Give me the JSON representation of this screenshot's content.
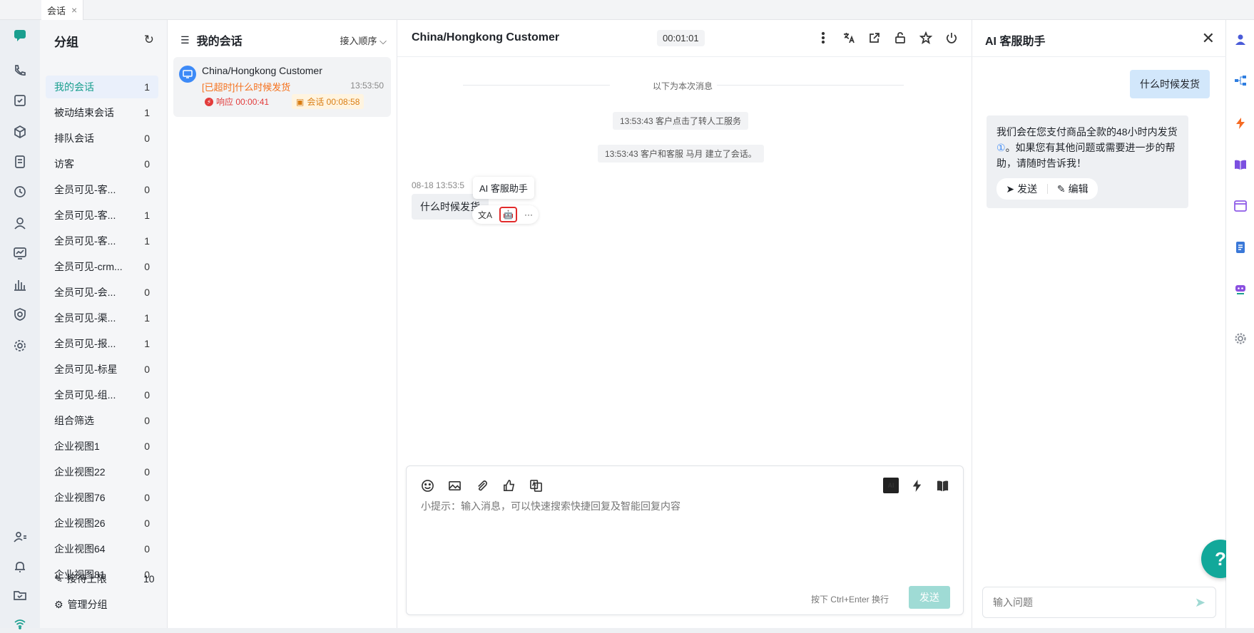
{
  "top_tab": {
    "label": "会话",
    "close": "×"
  },
  "groups": {
    "title": "分组",
    "items": [
      {
        "label": "我的会话",
        "count": "1"
      },
      {
        "label": "被动结束会话",
        "count": "1"
      },
      {
        "label": "排队会话",
        "count": "0"
      },
      {
        "label": "访客",
        "count": "0"
      },
      {
        "label": "全员可见-客...",
        "count": "0"
      },
      {
        "label": "全员可见-客...",
        "count": "1"
      },
      {
        "label": "全员可见-客...",
        "count": "1"
      },
      {
        "label": "全员可见-crm...",
        "count": "0"
      },
      {
        "label": "全员可见-会...",
        "count": "0"
      },
      {
        "label": "全员可见-渠...",
        "count": "1"
      },
      {
        "label": "全员可见-报...",
        "count": "1"
      },
      {
        "label": "全员可见-标星",
        "count": "0"
      },
      {
        "label": "全员可见-组...",
        "count": "0"
      },
      {
        "label": "组合筛选",
        "count": "0"
      },
      {
        "label": "企业视图1",
        "count": "0"
      },
      {
        "label": "企业视图22",
        "count": "0"
      },
      {
        "label": "企业视图76",
        "count": "0"
      },
      {
        "label": "企业视图26",
        "count": "0"
      },
      {
        "label": "企业视图64",
        "count": "0"
      },
      {
        "label": "企业视图81",
        "count": "0"
      }
    ],
    "reception_limit_label": "接待上限",
    "reception_limit_value": "10",
    "manage_label": "管理分组"
  },
  "conversations": {
    "title": "我的会话",
    "sort_label": "接入顺序",
    "card": {
      "name": "China/Hongkong Customer",
      "message": "[已超时]什么时候发货",
      "time": "13:53:50",
      "response_badge": "响应 00:00:41",
      "session_badge": "会话 00:08:58"
    }
  },
  "chat": {
    "title": "China/Hongkong Customer",
    "timer": "00:01:01",
    "divider_text": "以下为本次消息",
    "system_messages": [
      "13:53:43 客户点击了转人工服务",
      "13:53:43 客户和客服 马月 建立了会话。"
    ],
    "message_timestamp": "08-18 13:53:5",
    "customer_message": "什么时候发货",
    "tooltip": "AI 客服助手",
    "more_label": "···",
    "composer": {
      "placeholder": "小提示：输入消息，可以快速搜索快捷回复及智能回复内容",
      "hint": "按下 Ctrl+Enter 换行",
      "send_label": "发送",
      "ai_label": "AI"
    }
  },
  "ai_assistant": {
    "title": "AI 客服助手",
    "question": "什么时候发货",
    "answer_part1": "我们会在您支付商品全款的48小时内发货",
    "citation": "①",
    "answer_part2": "。如果您有其他问题或需要进一步的帮助，请随时告诉我！",
    "send_label": "发送",
    "edit_label": "编辑",
    "input_placeholder": "输入问题"
  },
  "colors": {
    "accent": "#1a9f8f",
    "warning": "#f5701b",
    "danger": "#e22b2b",
    "info": "#3d8af7"
  }
}
